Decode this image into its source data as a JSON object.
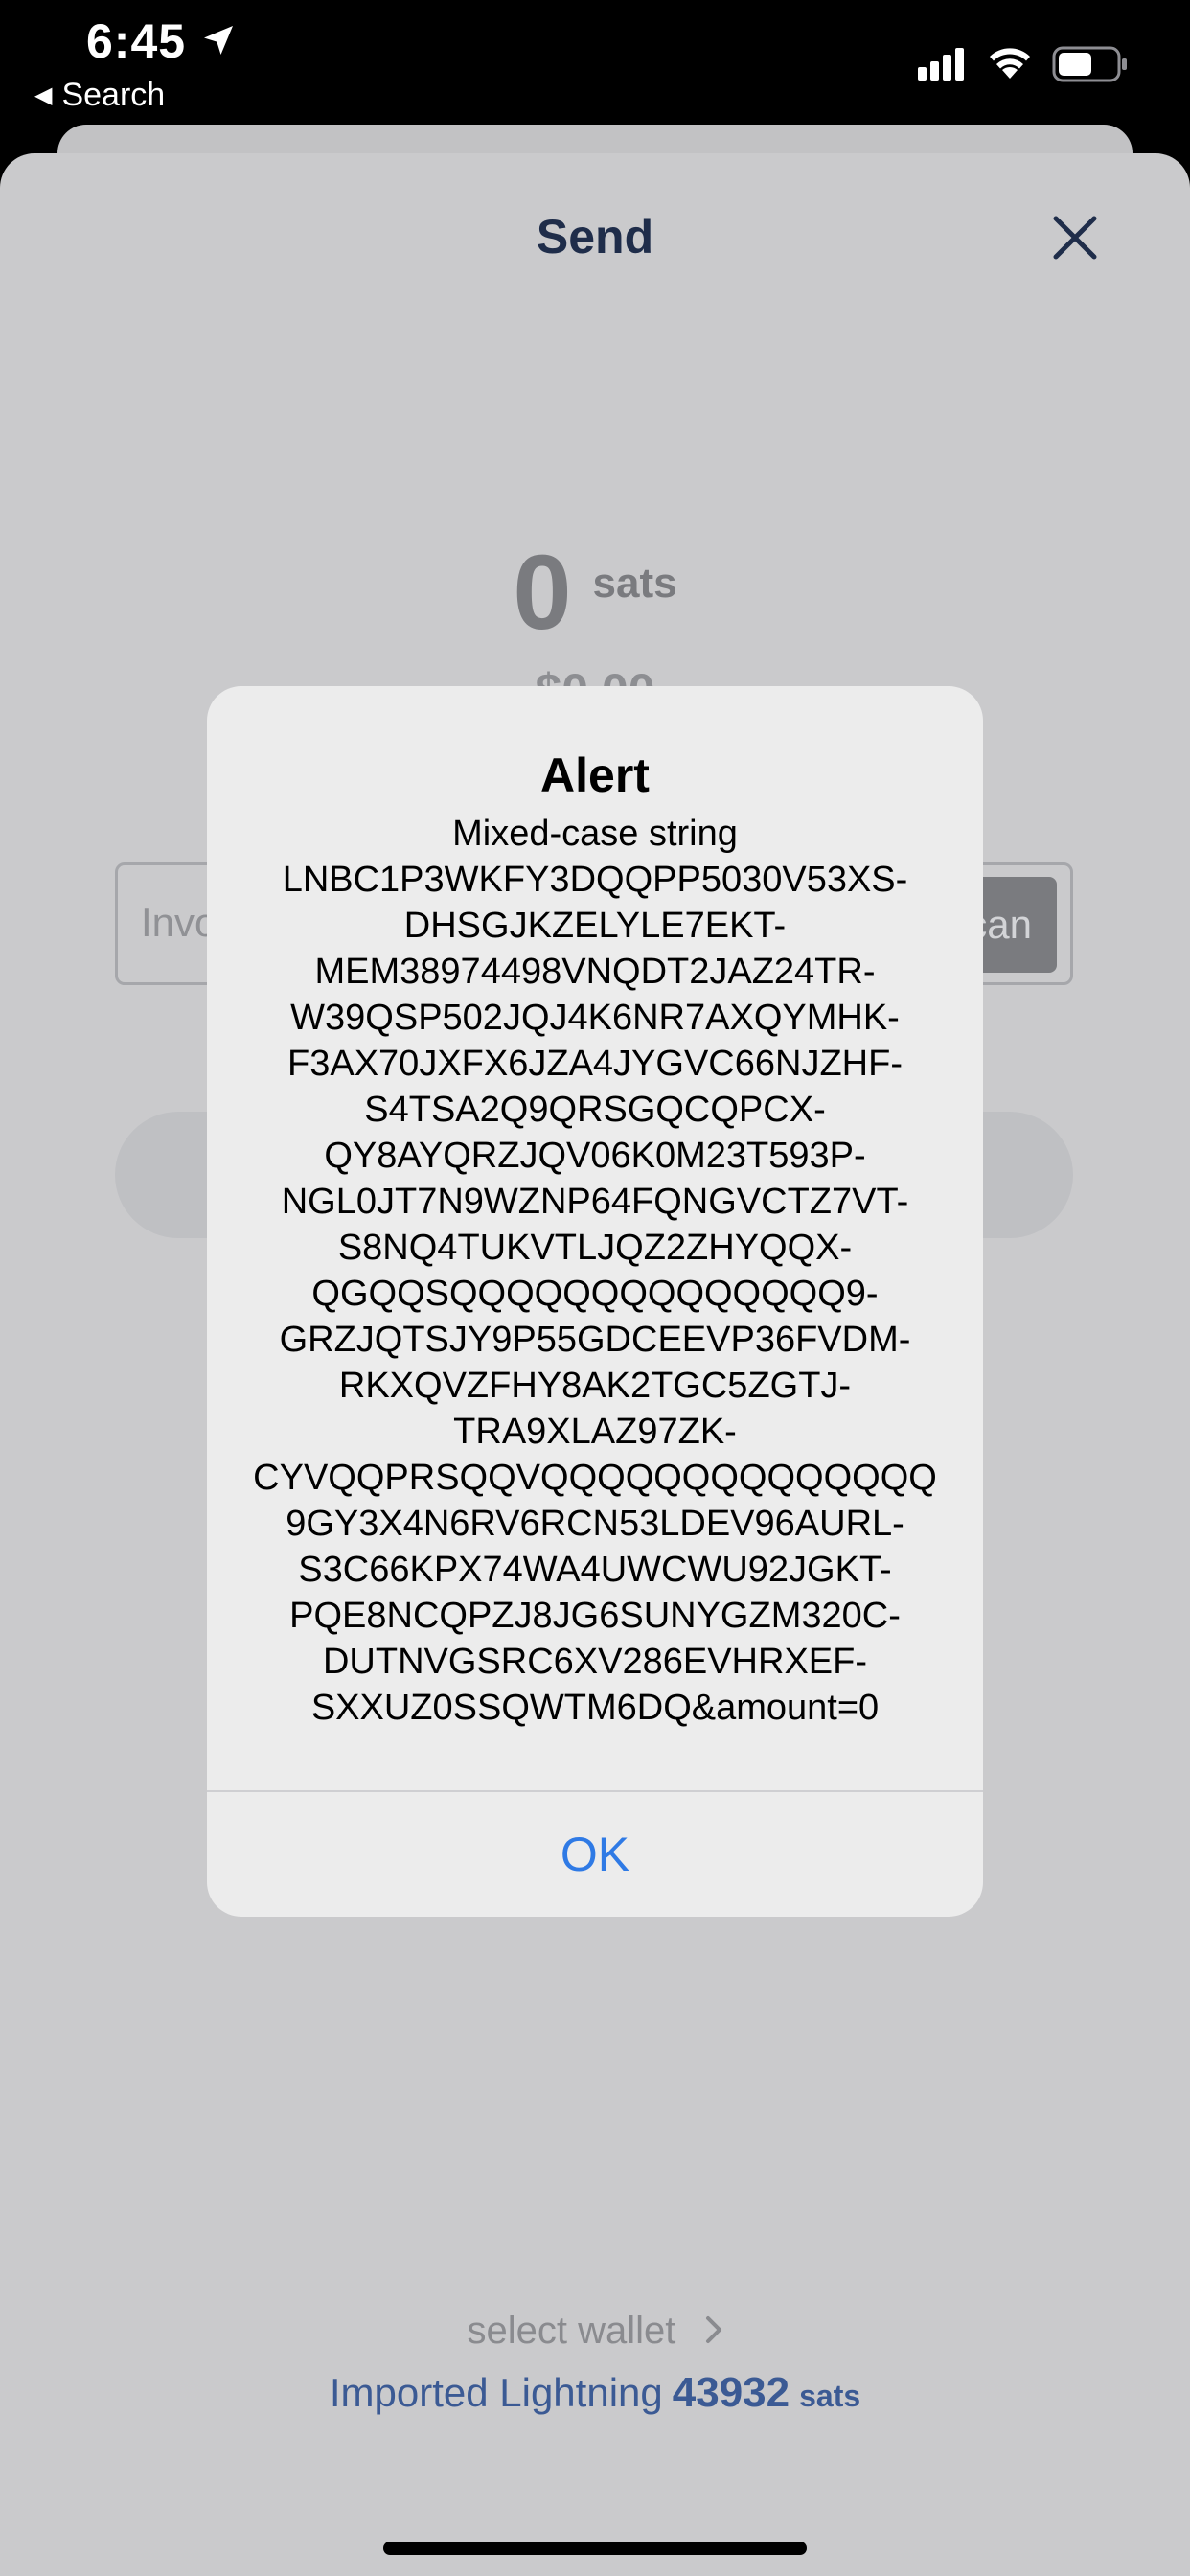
{
  "status_bar": {
    "time": "6:45",
    "back_label": "Search"
  },
  "sheet": {
    "title": "Send",
    "amount": "0",
    "amount_unit": "sats",
    "fiat_amount": "$0.00",
    "invoice_placeholder": "Invoice",
    "scan_label": "Scan",
    "select_wallet_label": "select wallet",
    "wallet_name": "Imported Lightning",
    "wallet_balance": "43932",
    "wallet_unit": "sats"
  },
  "alert": {
    "title": "Alert",
    "lines": [
      "Mixed-case string",
      "LNBC1P3WKFY3DQQPP5030V53XS-",
      "DHSGJKZELYLE7EKT-",
      "MEM38974498VNQDT2JAZ24TR-",
      "W39QSP502JQJ4K6NR7AXQYMHK-",
      "F3AX70JXFX6JZA4JYGVC66NJZHF-",
      "S4TSA2Q9QRSGQCQPCX-",
      "QY8AYQRZJQV06K0M23T593P-",
      "NGL0JT7N9WZNP64FQNGVCTZ7VT-",
      "S8NQ4TUKVTLJQZ2ZHYQQX-",
      "QGQQSQQQQQQQQQQQQQQ9-",
      "GRZJQTSJY9P55GDCEEVP36FVDM-",
      "RKXQVZFHY8AK2TGC5ZGTJ-",
      "TRA9XLAZ97ZK-",
      "CYVQQPRSQQVQQQQQQQQQQQQQQ",
      "9GY3X4N6RV6RCN53LDEV96AURL-",
      "S3C66KPX74WA4UWCWU92JGKT-",
      "PQE8NCQPZJ8JG6SUNYGZM320C-",
      "DUTNVGSRC6XV286EVHRXEF-",
      "SXXUZ0SSQWTM6DQ&amount=0"
    ],
    "ok_label": "OK"
  },
  "colors": {
    "accent": "#2f7ae5",
    "title_text": "#1f2d4a",
    "wallet_text": "#3b5a94"
  }
}
